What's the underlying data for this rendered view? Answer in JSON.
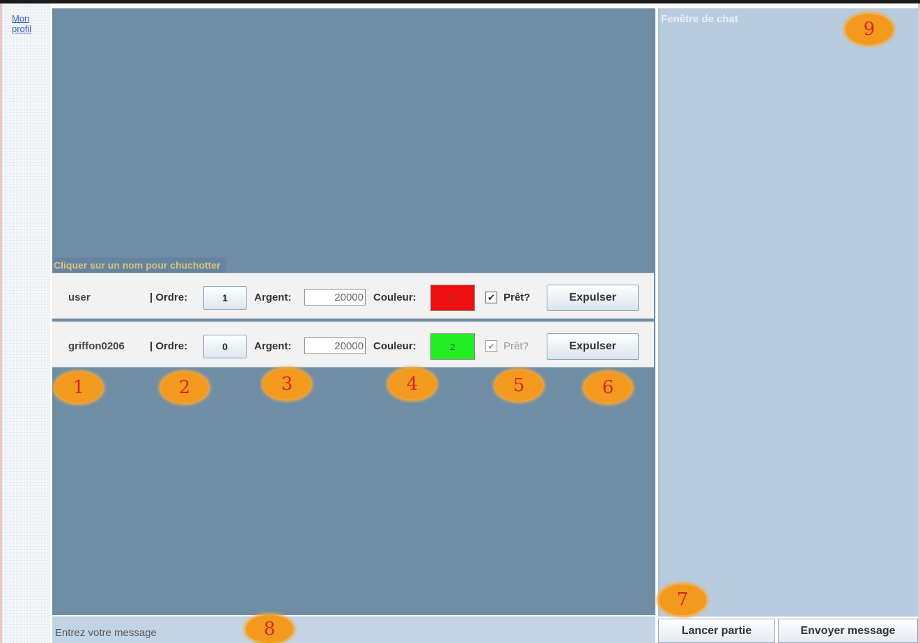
{
  "sidebar": {
    "profile_link": "Mon profil"
  },
  "lobby": {
    "whisper_hint": "Cliquer sur un nom pour chuchotter",
    "labels": {
      "ordre": "| Ordre:",
      "argent": "Argent:",
      "couleur": "Couleur:",
      "ready": "Prêt?",
      "kick": "Expulser"
    },
    "players": [
      {
        "name": "user",
        "ordre": "1",
        "argent": "20000",
        "couleur_value": "1",
        "couleur_hex": "#ee1010",
        "ready": true,
        "ready_enabled": true
      },
      {
        "name": "griffon0206",
        "ordre": "0",
        "argent": "20000",
        "couleur_value": "2",
        "couleur_hex": "#22ee22",
        "ready": true,
        "ready_enabled": false
      }
    ]
  },
  "chat": {
    "title": "Fenêtre de chat"
  },
  "message_bar": {
    "placeholder": "Entrez votre message"
  },
  "buttons": {
    "launch": "Lancer partie",
    "send": "Envoyer message"
  },
  "annotations": [
    "1",
    "2",
    "3",
    "4",
    "5",
    "6",
    "7",
    "8",
    "9"
  ],
  "colors": {
    "main_bg": "#6f8ea6",
    "chat_bg": "#b8cce0",
    "marker": "#f39a1e",
    "marker_text": "#d4262a"
  }
}
